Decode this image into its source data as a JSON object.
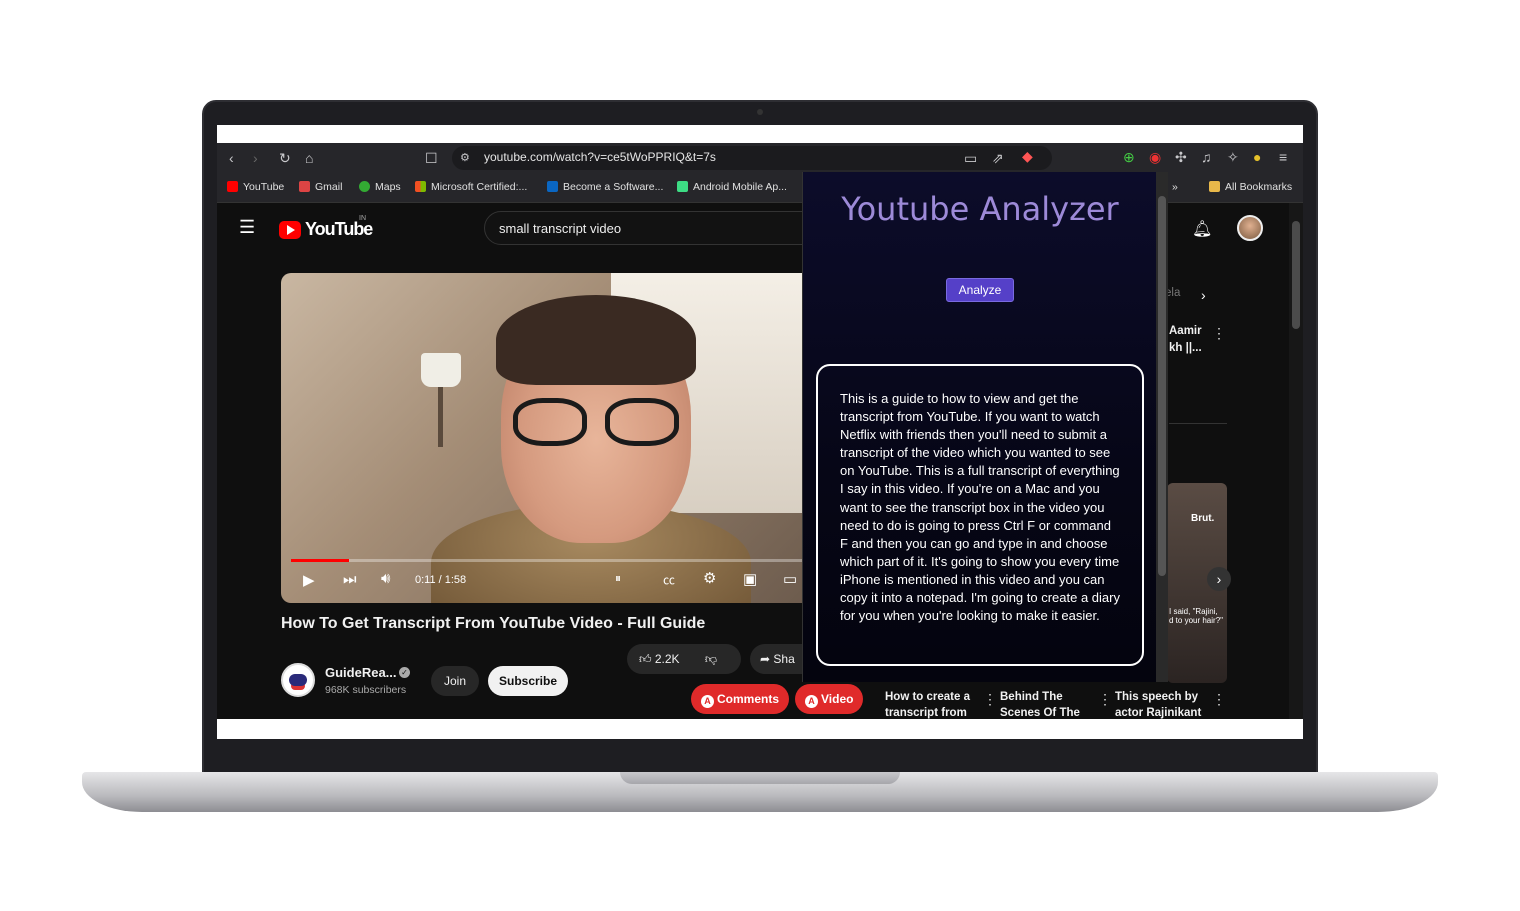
{
  "browser": {
    "url": "youtube.com/watch?v=ce5tWoPPRIQ&t=7s",
    "bookmarks": [
      "YouTube",
      "Gmail",
      "Maps",
      "Microsoft Certified:...",
      "Become a Software...",
      "Android Mobile Ap..."
    ],
    "all_bookmarks": "All Bookmarks",
    "more": "»"
  },
  "youtube": {
    "logo_text": "YouTube",
    "region": "IN",
    "search_query": "small transcript video",
    "player": {
      "time": "0:11 / 1:58",
      "progress_fraction": 0.11
    },
    "video_title": "How To Get Transcript From YouTube Video - Full Guide",
    "channel": {
      "name": "GuideRea...",
      "subscribers": "968K subscribers"
    },
    "join_label": "Join",
    "subscribe_label": "Subscribe",
    "like_count": "2.2K",
    "share_label": "Sha",
    "comments_btn": "Comments",
    "video_btn": "Video",
    "related": [
      "How to create a transcript from",
      "Behind The Scenes Of The",
      "This speech by actor Rajinikant"
    ],
    "side_snippets": [
      "ela",
      "Aamir",
      "kh ||...",
      "Brut.",
      "I said, \"Rajini,",
      "d to your hair?\""
    ]
  },
  "extension": {
    "title": "Youtube Analyzer",
    "analyze_label": "Analyze",
    "transcript": "This is a guide to how to view and get the transcript from YouTube. If you want to watch Netflix with friends then you'll need to submit a transcript of the video which you wanted to see on YouTube. This is a full transcript of everything I say in this video. If you're on a Mac and you want to see the transcript box in the video you need to do is going to press Ctrl F or command F and then you can go and type in and choose which part of it. It's going to show you every time iPhone is mentioned in this video and you can copy it into a notepad. I'm going to create a diary for you when you're looking to make it easier."
  },
  "colors": {
    "accent": "#ff0000",
    "extension_title": "#9d8ad8",
    "analyze_button": "#5540c8",
    "action_red": "#e02a2a"
  }
}
